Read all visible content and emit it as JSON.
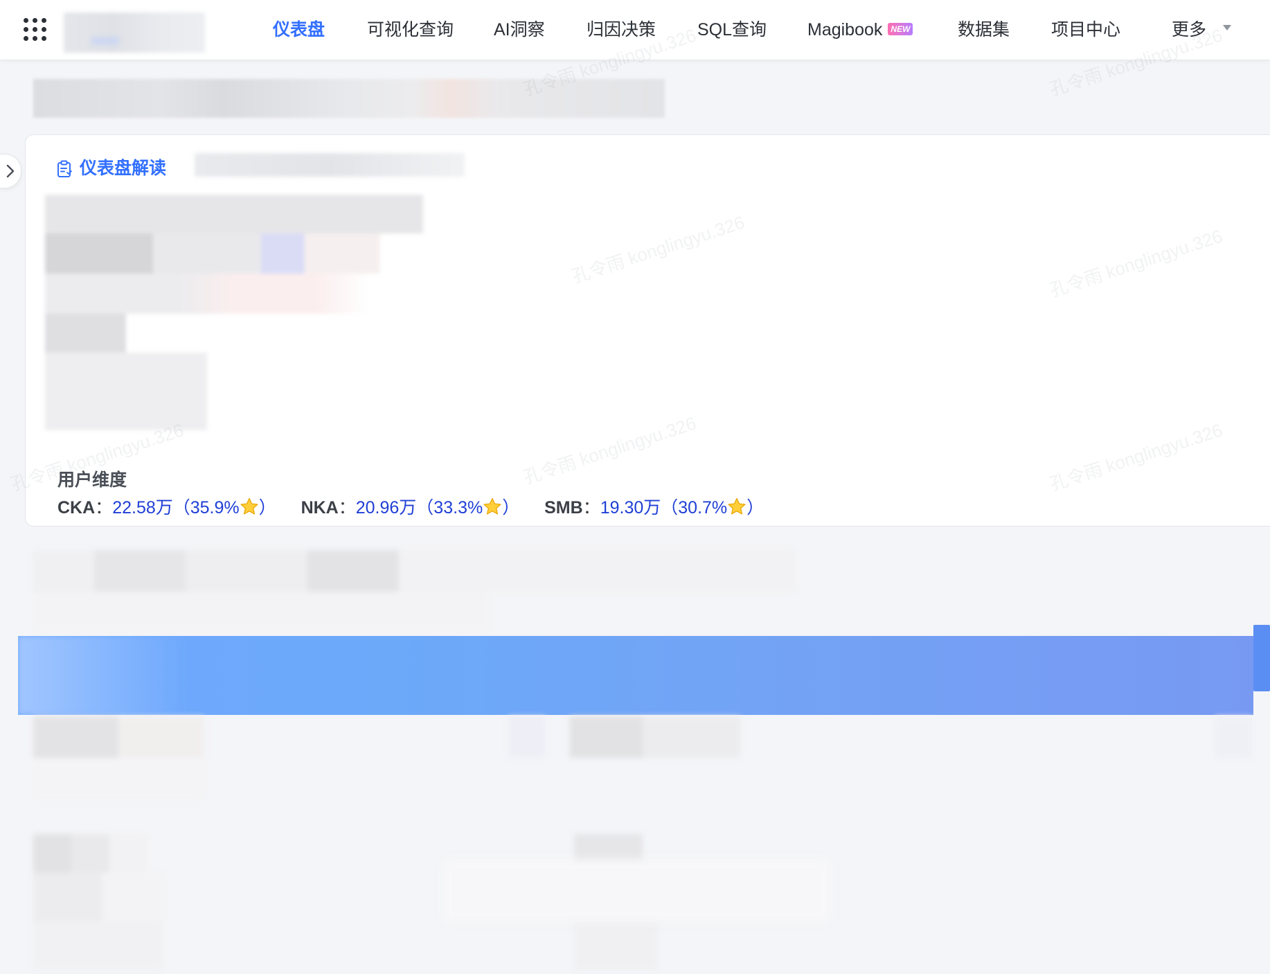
{
  "nav": {
    "items": [
      {
        "label": "仪表盘",
        "active": true
      },
      {
        "label": "可视化查询"
      },
      {
        "label": "AI洞察"
      },
      {
        "label": "归因决策"
      },
      {
        "label": "SQL查询"
      },
      {
        "label": "Magibook",
        "badge": "NEW"
      },
      {
        "label": "数据集"
      },
      {
        "label": "项目中心"
      },
      {
        "label": "更多"
      }
    ],
    "menu_icon": "grid-icon",
    "more_icon": "caret-down-icon"
  },
  "card": {
    "title": "仪表盘解读",
    "title_icon": "clipboard-icon",
    "dimension_label": "用户维度",
    "segments": [
      {
        "name": "CKA",
        "sep": "：",
        "value": "22.58万（35.9%",
        "close": "）"
      },
      {
        "name": "NKA",
        "sep": "：",
        "value": "20.96万（33.3%",
        "close": "）"
      },
      {
        "name": "SMB",
        "sep": "：",
        "value": "19.30万（30.7%",
        "close": "）"
      }
    ]
  },
  "watermark": "孔令雨 konglingyu.326",
  "colors": {
    "accent": "#3370ff",
    "value_text": "#1f3fd6",
    "highlight_bar": "#6fa8ff"
  }
}
